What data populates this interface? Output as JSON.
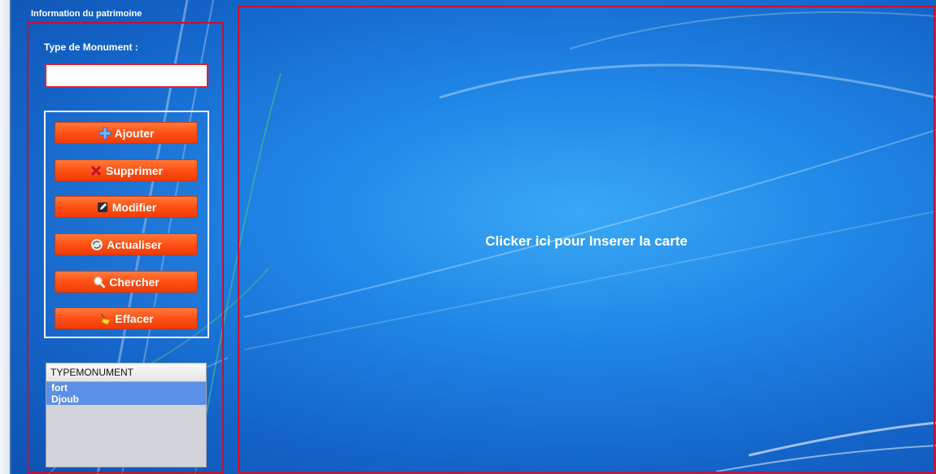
{
  "panel": {
    "title": "Information du patrimoine",
    "field_label": "Type de Monument :",
    "field_value": ""
  },
  "buttons": {
    "ajouter": {
      "label": "Ajouter",
      "icon": "plus-icon"
    },
    "supprimer": {
      "label": "Supprimer",
      "icon": "x-icon"
    },
    "modifier": {
      "label": "Modifier",
      "icon": "pencil-icon"
    },
    "actualiser": {
      "label": "Actualiser",
      "icon": "refresh-icon"
    },
    "chercher": {
      "label": "Chercher",
      "icon": "magnifier-icon"
    },
    "effacer": {
      "label": "Effacer",
      "icon": "broom-icon"
    }
  },
  "list": {
    "header": "TYPEMONUMENT",
    "items": [
      "fort",
      "Djoub"
    ]
  },
  "map": {
    "prompt": "Clicker ici pour Inserer la carte"
  },
  "colors": {
    "frame_border": "#c8102e",
    "button": "#ff5014",
    "list_selection": "#5b8fe8",
    "background": "#1f86e6"
  }
}
